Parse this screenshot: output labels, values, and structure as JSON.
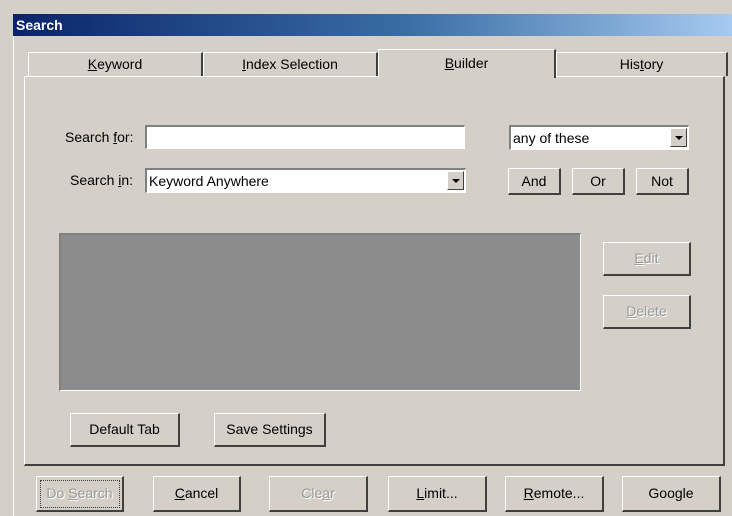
{
  "window": {
    "title": "Search"
  },
  "tabs": [
    {
      "label": "Keyword",
      "accel": "K",
      "active": false
    },
    {
      "label": "Index Selection",
      "accel": "I",
      "active": false
    },
    {
      "label": "Builder",
      "accel": "B",
      "active": true
    },
    {
      "label": "History",
      "accel": "t",
      "active": false
    }
  ],
  "builder": {
    "search_for": {
      "label": "Search for:",
      "value": ""
    },
    "search_in": {
      "label": "Search in:",
      "value": "Keyword Anywhere"
    },
    "match_mode": {
      "value": "any of these"
    },
    "operators": {
      "and": "And",
      "or": "Or",
      "not": "Not"
    },
    "edit_button": "Edit",
    "delete_button": "Delete",
    "default_tab_button": "Default Tab",
    "save_settings_button": "Save Settings"
  },
  "footer": {
    "do_search": "Do Search",
    "cancel": "Cancel",
    "clear": "Clear",
    "limit": "Limit...",
    "remote": "Remote...",
    "google": "Google"
  },
  "colors": {
    "dialog_bg": "#d4d0c8",
    "title_start": "#0a246a",
    "title_end": "#a6caf0",
    "listbox_bg": "#8c8c8c",
    "disabled_text": "#9a9a9a"
  }
}
